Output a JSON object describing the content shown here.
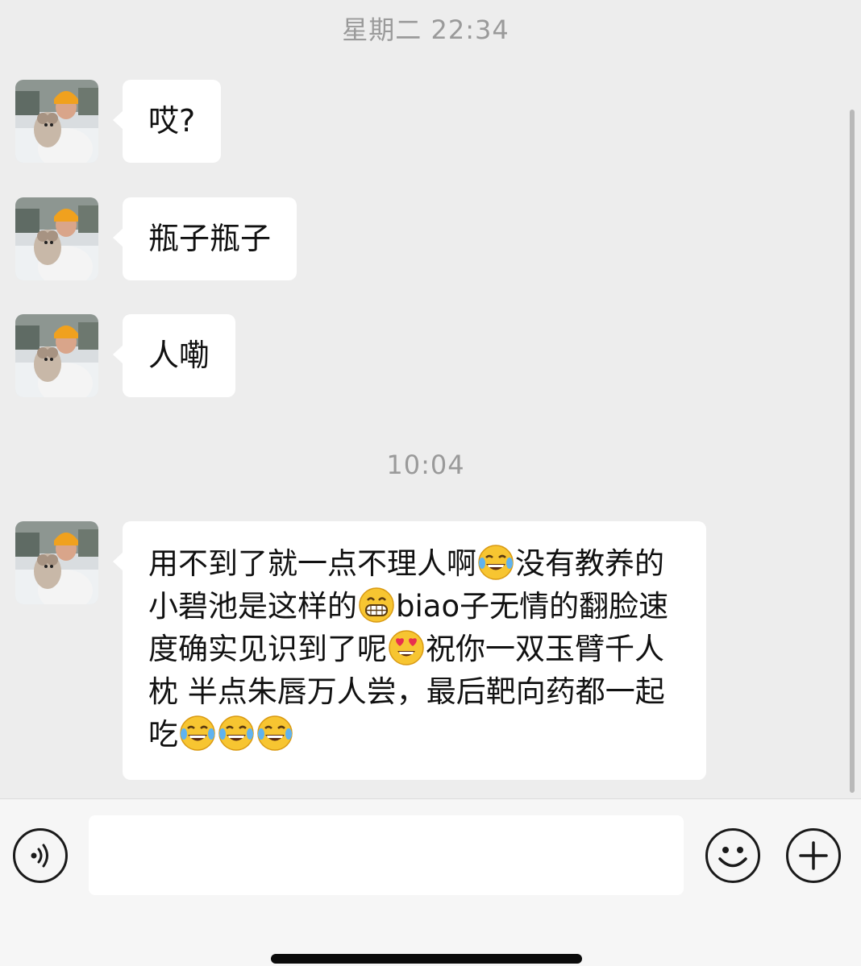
{
  "timestamps": {
    "first": "星期二 22:34",
    "second": "10:04"
  },
  "messages": [
    {
      "text": "哎?"
    },
    {
      "text": "瓶子瓶子"
    },
    {
      "text": "人嘞"
    }
  ],
  "long_message": {
    "part1": "用不到了就一点不理人啊",
    "emoji1": "joy-emoji",
    "part2": "没有教养的小碧池是这样的",
    "emoji2": "grin-emoji",
    "part3": "biao子无情的翻脸速度确实见识到了呢",
    "emoji3": "heart-eyes-emoji",
    "part4": "祝你一双玉臂千人枕 半点朱唇万人尝，最后靶向药都一起吃",
    "emoji_tail": [
      "joy-emoji",
      "joy-emoji",
      "joy-emoji"
    ]
  },
  "input": {
    "value": "",
    "placeholder": ""
  },
  "icons": {
    "voice": "voice-icon",
    "emoji": "smiley-icon",
    "more": "plus-icon"
  },
  "colors": {
    "background": "#ededed",
    "bubble": "#ffffff",
    "input_bar": "#f6f6f6"
  }
}
